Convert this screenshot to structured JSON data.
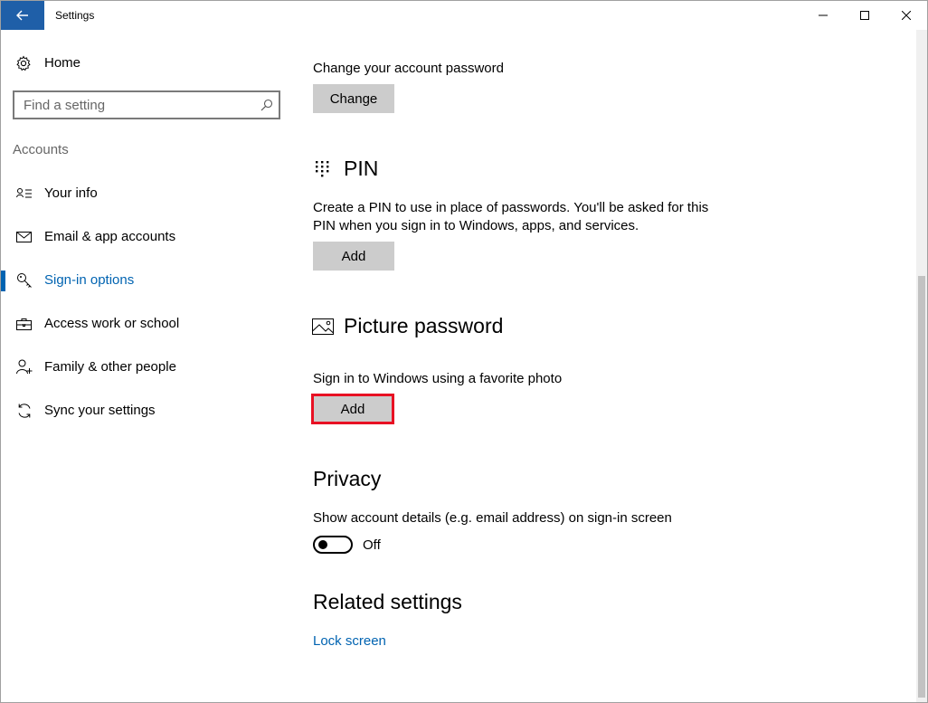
{
  "window": {
    "title": "Settings"
  },
  "sidebar": {
    "home_label": "Home",
    "search_placeholder": "Find a setting",
    "section_label": "Accounts",
    "items": [
      {
        "label": "Your info",
        "icon": "contact-card-icon"
      },
      {
        "label": "Email & app accounts",
        "icon": "mail-icon"
      },
      {
        "label": "Sign-in options",
        "icon": "key-icon",
        "active": true
      },
      {
        "label": "Access work or school",
        "icon": "briefcase-icon"
      },
      {
        "label": "Family & other people",
        "icon": "person-add-icon"
      },
      {
        "label": "Sync your settings",
        "icon": "sync-icon"
      }
    ]
  },
  "main": {
    "password": {
      "description": "Change your account password",
      "button_label": "Change"
    },
    "pin": {
      "heading": "PIN",
      "description_line1": "Create a PIN to use in place of passwords. You'll be asked for this",
      "description_line2": "PIN when you sign in to Windows, apps, and services.",
      "button_label": "Add"
    },
    "picture_password": {
      "heading": "Picture password",
      "description": "Sign in to Windows using a favorite photo",
      "button_label": "Add"
    },
    "privacy": {
      "heading": "Privacy",
      "description": "Show account details (e.g. email address) on sign-in screen",
      "toggle_state": "Off"
    },
    "related": {
      "heading": "Related settings",
      "link_label": "Lock screen"
    }
  },
  "colors": {
    "accent": "#0063b1",
    "highlight": "#e81123",
    "button_bg": "#cccccc"
  }
}
